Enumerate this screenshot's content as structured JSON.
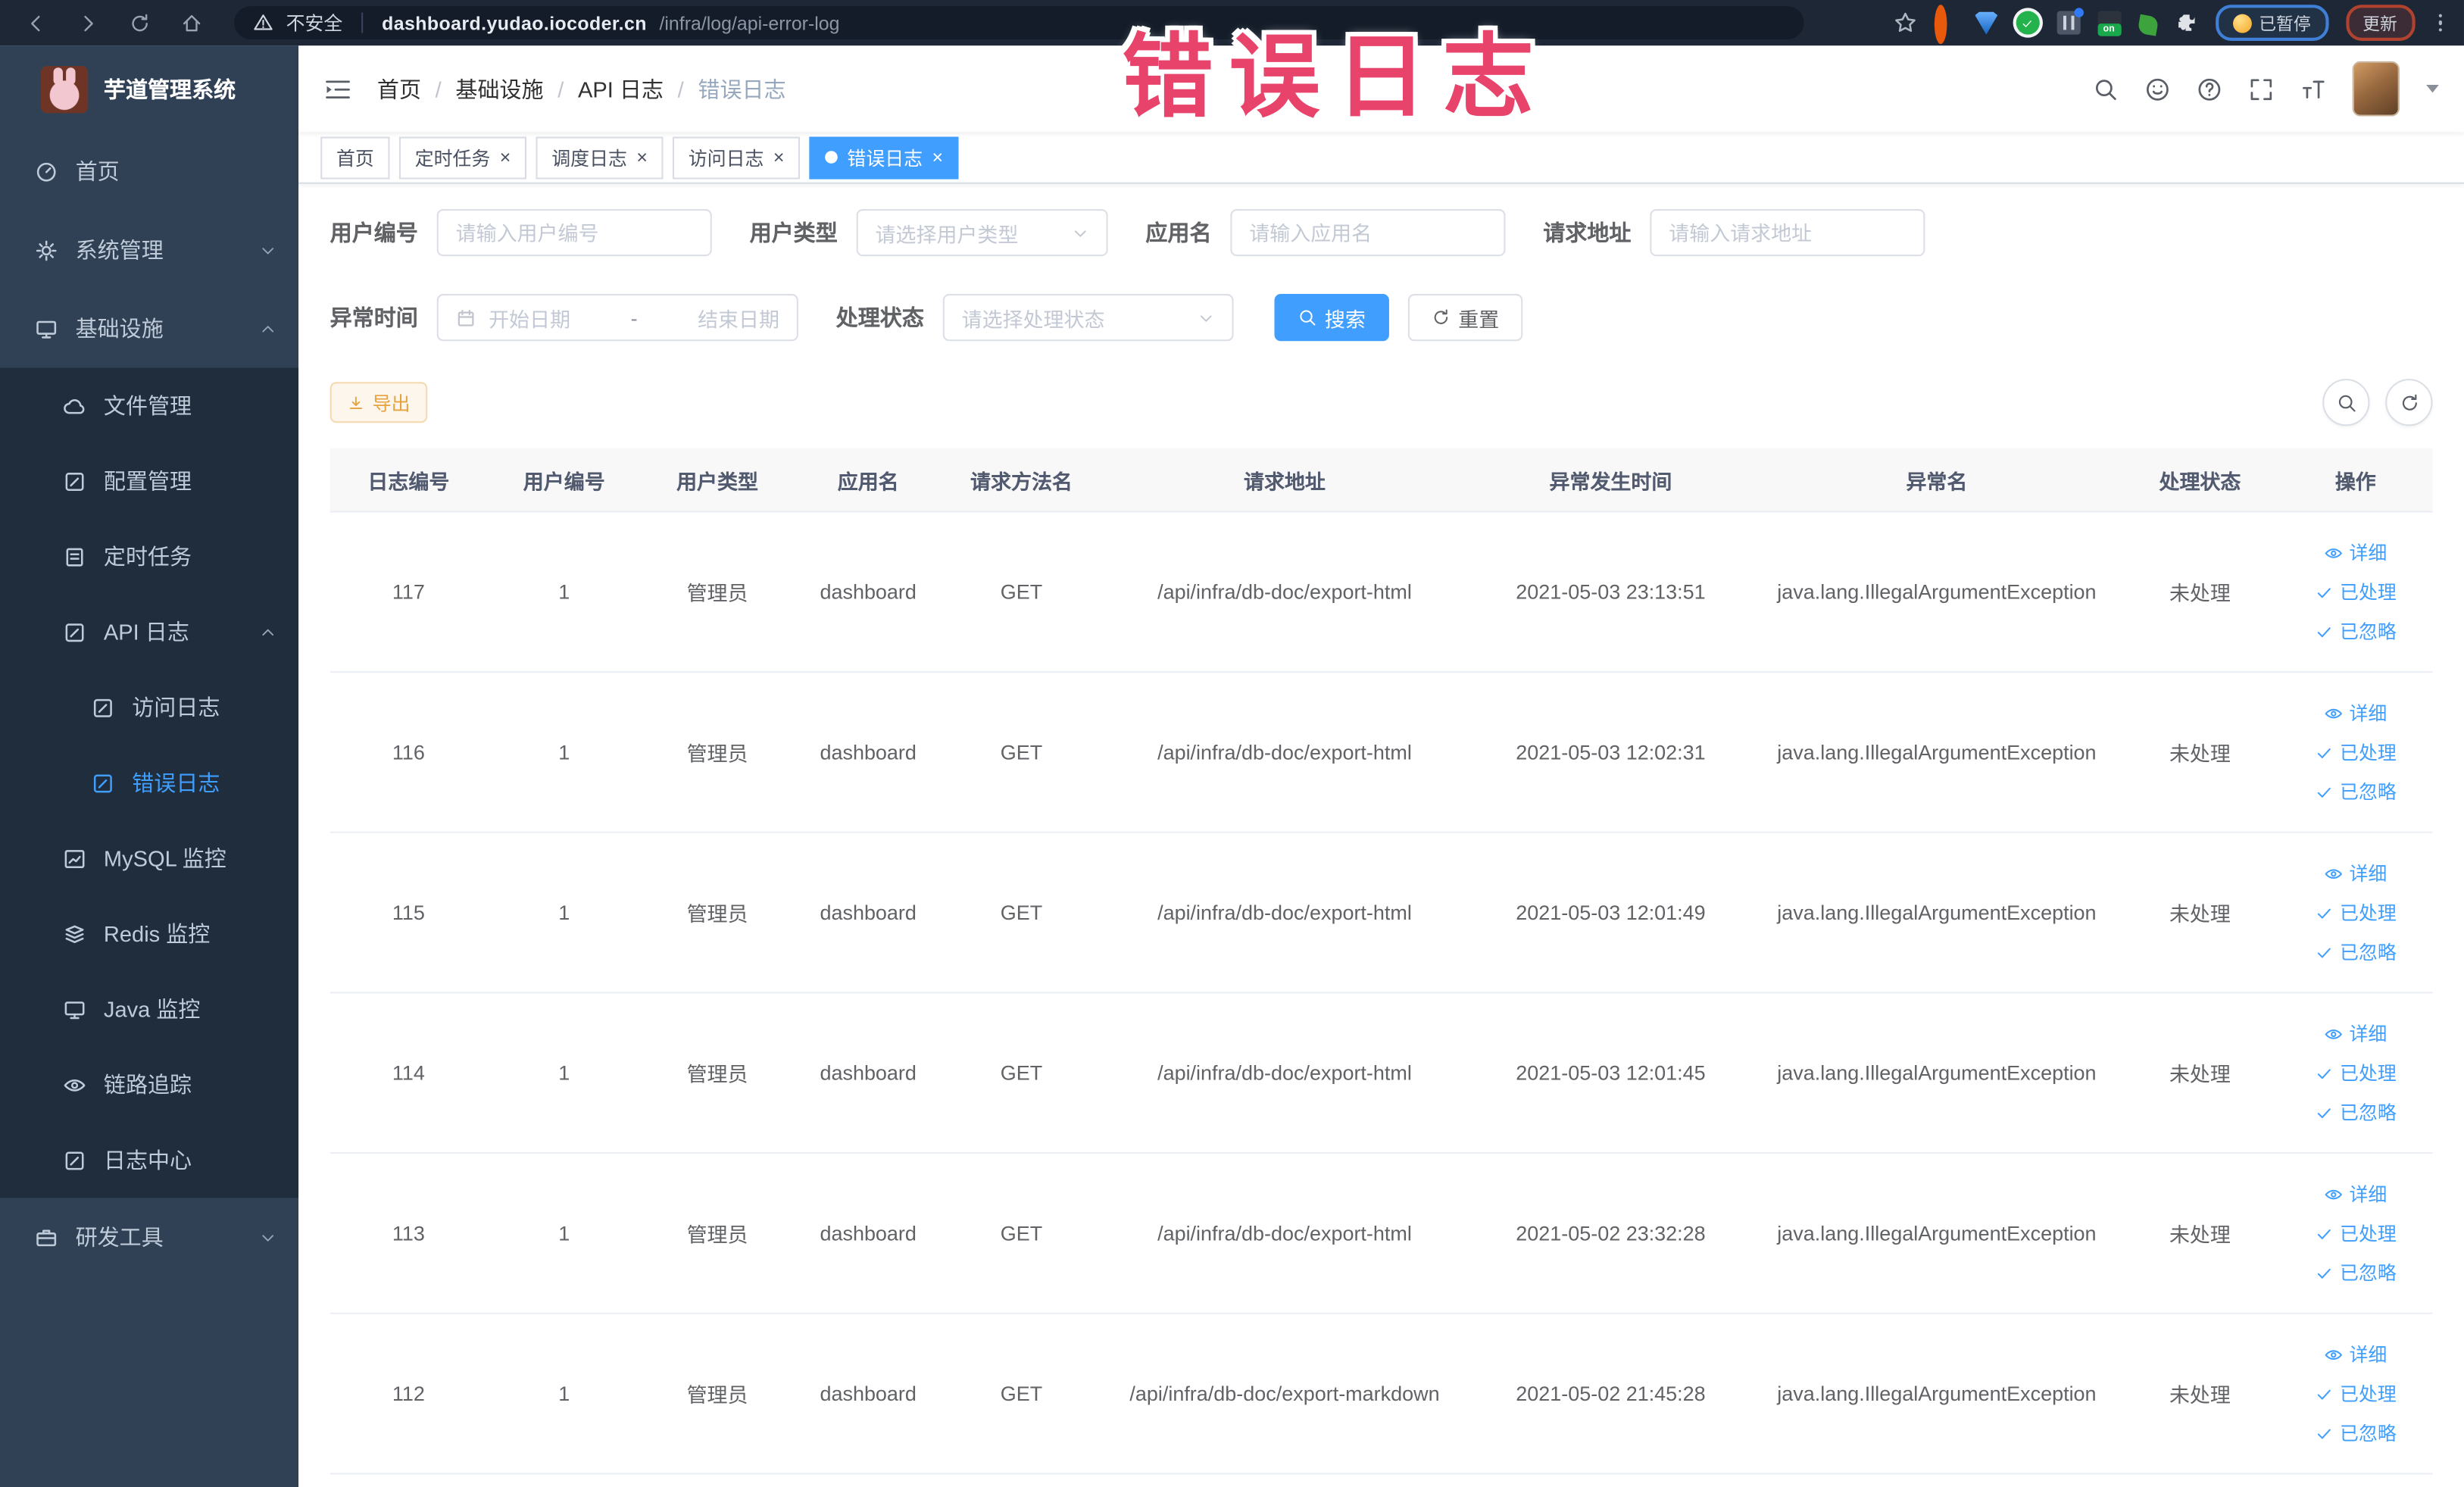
{
  "browser": {
    "security_label": "不安全",
    "url_host": "dashboard.yudao.iocoder.cn",
    "url_path": "/infra/log/api-error-log",
    "on_badge": "on",
    "paused_label": "已暂停",
    "update_label": "更新"
  },
  "overlay": {
    "text": "错误日志"
  },
  "sidebar": {
    "title": "芋道管理系统",
    "items": [
      {
        "label": "首页"
      },
      {
        "label": "系统管理"
      },
      {
        "label": "基础设施"
      },
      {
        "label": "文件管理"
      },
      {
        "label": "配置管理"
      },
      {
        "label": "定时任务"
      },
      {
        "label": "API 日志"
      },
      {
        "label": "访问日志"
      },
      {
        "label": "错误日志"
      },
      {
        "label": "MySQL 监控"
      },
      {
        "label": "Redis 监控"
      },
      {
        "label": "Java 监控"
      },
      {
        "label": "链路追踪"
      },
      {
        "label": "日志中心"
      },
      {
        "label": "研发工具"
      }
    ]
  },
  "header": {
    "breadcrumb": [
      "首页",
      "基础设施",
      "API 日志",
      "错误日志"
    ],
    "breadcrumb_separator": "/"
  },
  "tabs": [
    {
      "label": "首页",
      "active": false,
      "closable": false
    },
    {
      "label": "定时任务",
      "active": false,
      "closable": true
    },
    {
      "label": "调度日志",
      "active": false,
      "closable": true
    },
    {
      "label": "访问日志",
      "active": false,
      "closable": true
    },
    {
      "label": "错误日志",
      "active": true,
      "closable": true
    }
  ],
  "filters": {
    "user_id": {
      "label": "用户编号",
      "placeholder": "请输入用户编号"
    },
    "user_type": {
      "label": "用户类型",
      "placeholder": "请选择用户类型"
    },
    "app_name": {
      "label": "应用名",
      "placeholder": "请输入应用名"
    },
    "request_url": {
      "label": "请求地址",
      "placeholder": "请输入请求地址"
    },
    "exception_time": {
      "label": "异常时间",
      "start_placeholder": "开始日期",
      "separator": "-",
      "end_placeholder": "结束日期"
    },
    "process_status": {
      "label": "处理状态",
      "placeholder": "请选择处理状态"
    },
    "search_label": "搜索",
    "reset_label": "重置"
  },
  "toolbar": {
    "export_label": "导出"
  },
  "table": {
    "columns": [
      "日志编号",
      "用户编号",
      "用户类型",
      "应用名",
      "请求方法名",
      "请求地址",
      "异常发生时间",
      "异常名",
      "处理状态",
      "操作"
    ],
    "actions": [
      "详细",
      "已处理",
      "已忽略"
    ],
    "rows": [
      {
        "id": "117",
        "user_id": "1",
        "user_type": "管理员",
        "app": "dashboard",
        "method": "GET",
        "url": "/api/infra/db-doc/export-html",
        "time": "2021-05-03 23:13:51",
        "exception": "java.lang.IllegalArgumentException",
        "status": "未处理"
      },
      {
        "id": "116",
        "user_id": "1",
        "user_type": "管理员",
        "app": "dashboard",
        "method": "GET",
        "url": "/api/infra/db-doc/export-html",
        "time": "2021-05-03 12:02:31",
        "exception": "java.lang.IllegalArgumentException",
        "status": "未处理"
      },
      {
        "id": "115",
        "user_id": "1",
        "user_type": "管理员",
        "app": "dashboard",
        "method": "GET",
        "url": "/api/infra/db-doc/export-html",
        "time": "2021-05-03 12:01:49",
        "exception": "java.lang.IllegalArgumentException",
        "status": "未处理"
      },
      {
        "id": "114",
        "user_id": "1",
        "user_type": "管理员",
        "app": "dashboard",
        "method": "GET",
        "url": "/api/infra/db-doc/export-html",
        "time": "2021-05-03 12:01:45",
        "exception": "java.lang.IllegalArgumentException",
        "status": "未处理"
      },
      {
        "id": "113",
        "user_id": "1",
        "user_type": "管理员",
        "app": "dashboard",
        "method": "GET",
        "url": "/api/infra/db-doc/export-html",
        "time": "2021-05-02 23:32:28",
        "exception": "java.lang.IllegalArgumentException",
        "status": "未处理"
      },
      {
        "id": "112",
        "user_id": "1",
        "user_type": "管理员",
        "app": "dashboard",
        "method": "GET",
        "url": "/api/infra/db-doc/export-markdown",
        "time": "2021-05-02 21:45:28",
        "exception": "java.lang.IllegalArgumentException",
        "status": "未处理"
      }
    ]
  },
  "colors": {
    "primary": "#409eff",
    "sidebar_bg": "#304156",
    "sidebar_submenu_bg": "#1f2d3d",
    "sidebar_text": "#bfcbd9",
    "active_tab_bg": "#409eff",
    "export_bg": "#fdf6ec",
    "export_border": "#f5dab1",
    "export_text": "#e6a23c",
    "overlay_pink": "#e8436b",
    "browser_bar_bg": "#1d2736"
  }
}
